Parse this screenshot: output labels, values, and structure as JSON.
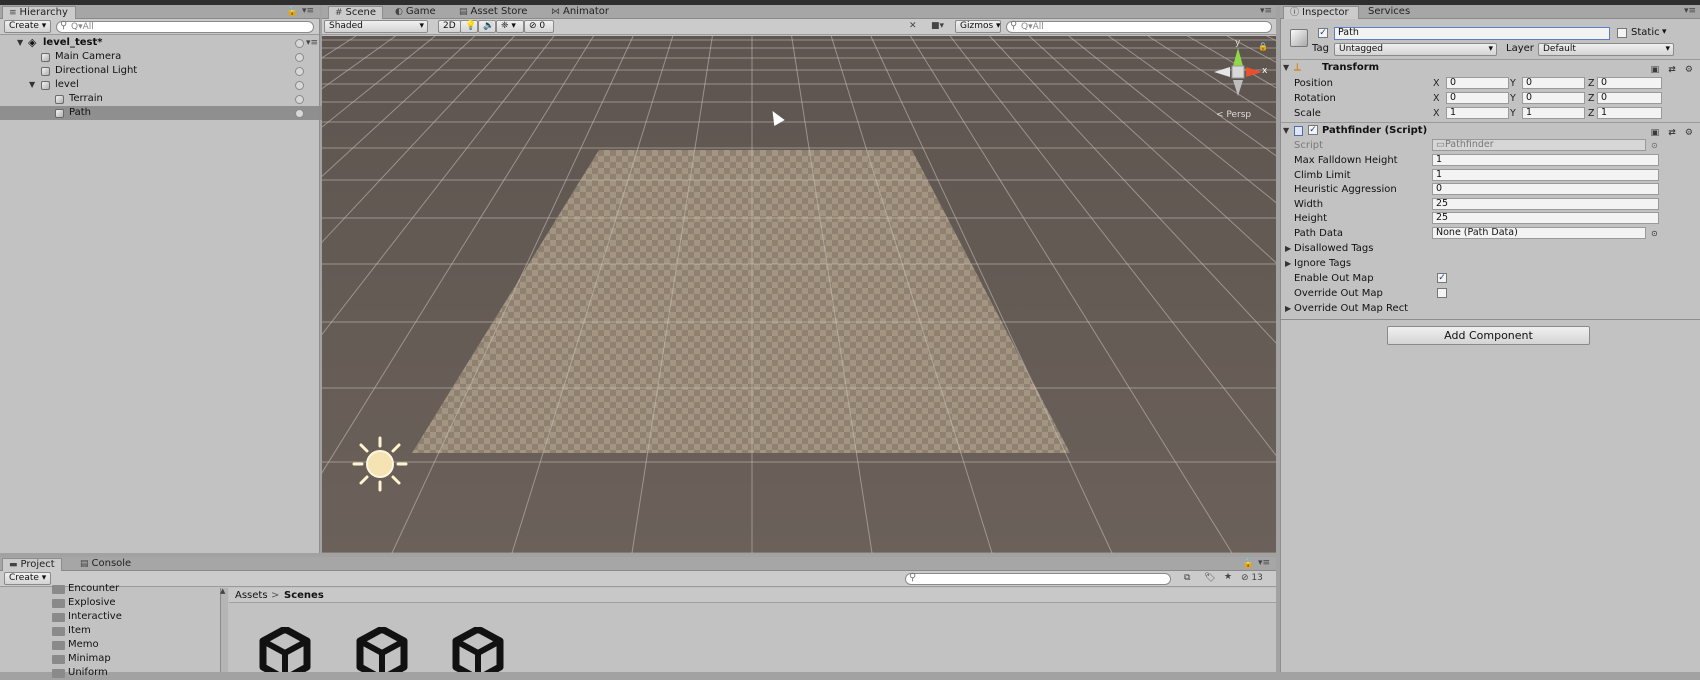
{
  "hierarchy": {
    "tab_label": "Hierarchy",
    "create_label": "Create",
    "search_placeholder": "Q▾All",
    "scene_name": "level_test*",
    "items": [
      {
        "label": "Main Camera",
        "indent": 1,
        "expand": ""
      },
      {
        "label": "Directional Light",
        "indent": 1,
        "expand": ""
      },
      {
        "label": "level",
        "indent": 1,
        "expand": "▼"
      },
      {
        "label": "Terrain",
        "indent": 2,
        "expand": ""
      },
      {
        "label": "Path",
        "indent": 2,
        "expand": "",
        "selected": true
      }
    ]
  },
  "scene_view": {
    "tabs": [
      {
        "label": "Scene",
        "icon": "grid-icon"
      },
      {
        "label": "Game",
        "icon": "pacman-icon"
      },
      {
        "label": "Asset Store",
        "icon": "bag-icon"
      },
      {
        "label": "Animator",
        "icon": "animator-icon"
      }
    ],
    "shading_mode": "Shaded",
    "mode_2d_label": "2D",
    "effects_count": "0",
    "gizmos_label": "Gizmos",
    "search_placeholder": "Q▾All",
    "persp_label": "< Persp",
    "gizmo_axes": {
      "y": "y",
      "x": "x"
    }
  },
  "inspector": {
    "tabs": [
      "Inspector",
      "Services"
    ],
    "object_name": "Path",
    "static_label": "Static",
    "tag_label": "Tag",
    "tag_value": "Untagged",
    "layer_label": "Layer",
    "layer_value": "Default",
    "transform": {
      "title": "Transform",
      "rows": [
        {
          "label": "Position",
          "x": "0",
          "y": "0",
          "z": "0"
        },
        {
          "label": "Rotation",
          "x": "0",
          "y": "0",
          "z": "0"
        },
        {
          "label": "Scale",
          "x": "1",
          "y": "1",
          "z": "1"
        }
      ]
    },
    "pathfinder": {
      "title": "Pathfinder (Script)",
      "script_label": "Script",
      "script_value": "Pathfinder",
      "fields": [
        {
          "label": "Max Falldown Height",
          "value": "1"
        },
        {
          "label": "Climb Limit",
          "value": "1"
        },
        {
          "label": "Heuristic Aggression",
          "value": "0"
        },
        {
          "label": "Width",
          "value": "25"
        },
        {
          "label": "Height",
          "value": "25"
        }
      ],
      "path_data_label": "Path Data",
      "path_data_value": "None (Path Data)",
      "disallowed_tags": "Disallowed Tags",
      "ignore_tags": "Ignore Tags",
      "enable_out_map": "Enable Out Map",
      "enable_out_map_checked": true,
      "override_out_map": "Override Out Map",
      "override_out_map_checked": false,
      "override_out_map_rect": "Override Out Map Rect"
    },
    "add_component_label": "Add Component"
  },
  "project": {
    "tabs": [
      "Project",
      "Console"
    ],
    "create_label": "Create",
    "folders": [
      "Encounter",
      "Explosive",
      "Interactive",
      "Item",
      "Memo",
      "Minimap",
      "Uniform"
    ],
    "breadcrumb_root": "Assets",
    "breadcrumb_current": "Scenes",
    "hidden_count": "13"
  }
}
